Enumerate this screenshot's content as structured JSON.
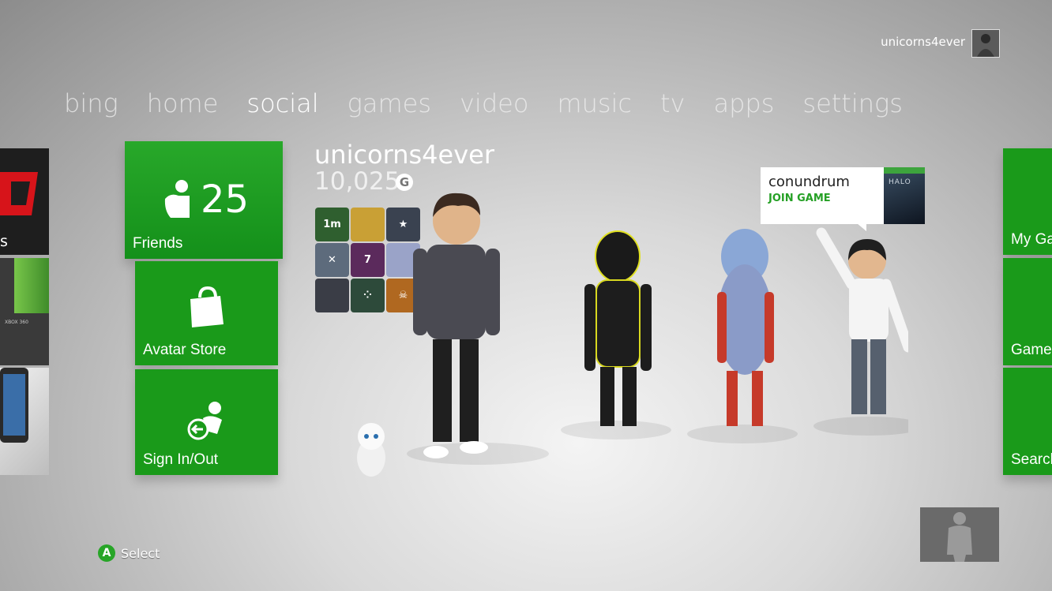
{
  "header": {
    "gamertag": "unicorns4ever"
  },
  "nav": {
    "tabs": [
      "bing",
      "home",
      "social",
      "games",
      "video",
      "music",
      "tv",
      "apps",
      "settings"
    ],
    "active": "social"
  },
  "left_tiles": [
    {
      "label": "s"
    },
    {
      "label": "XBOX 360"
    }
  ],
  "tiles": {
    "friends": {
      "label": "Friends",
      "count": "25"
    },
    "avatar_store": {
      "label": "Avatar Store"
    },
    "sign_in_out": {
      "label": "Sign In/Out"
    }
  },
  "profile": {
    "gamertag": "unicorns4ever",
    "gamerscore": "10,025",
    "score_badge": "G",
    "badges": [
      {
        "icon": "1m",
        "color": "#2f5f2f"
      },
      {
        "icon": "gold-wing-badge",
        "color": "#c9a035"
      },
      {
        "icon": "star-chevron-badge",
        "color": "#3a4250"
      },
      {
        "icon": "crossed-swords-badge",
        "color": "#5d6b7c"
      },
      {
        "icon": "7",
        "color": "#5b2a5c"
      },
      {
        "icon": "feather-badge",
        "color": "#9aa3c8"
      },
      {
        "icon": "pilot-cap-badge",
        "color": "#3a3d46"
      },
      {
        "icon": "dots-emblem-badge",
        "color": "#2d4a3a"
      },
      {
        "icon": "skull-hex-badge",
        "color": "#b06820"
      }
    ]
  },
  "friend_popup": {
    "name": "conundrum",
    "action": "JOIN GAME",
    "game_title": "HALO"
  },
  "right_tiles": [
    {
      "label": "My Ga"
    },
    {
      "label": "Game"
    },
    {
      "label": "Search"
    }
  ],
  "footer": {
    "button_letter": "A",
    "hint": "Select"
  },
  "colors": {
    "tile_green": "#1a9a1a",
    "accent_green": "#25a025"
  }
}
